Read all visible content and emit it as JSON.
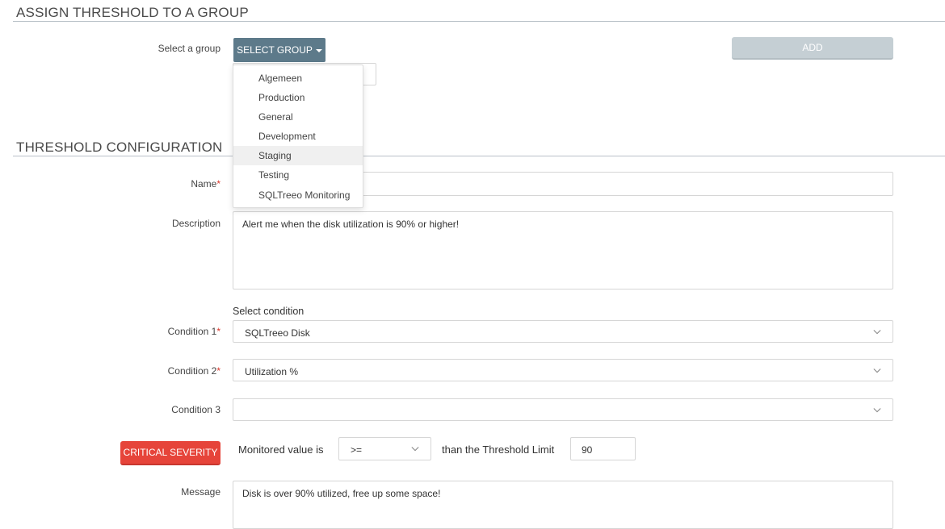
{
  "assign_section": {
    "title": "ASSIGN THRESHOLD TO A GROUP",
    "select_label": "Select a group",
    "select_button": "SELECT GROUP",
    "add_button": "ADD",
    "dropdown_items": [
      "Algemeen",
      "Production",
      "General",
      "Development",
      "Staging",
      "Testing",
      "SQLTreeo Monitoring"
    ],
    "highlighted_item": "Staging"
  },
  "config_section": {
    "title": "THRESHOLD CONFIGURATION",
    "name_label": "Name",
    "name_value": "",
    "description_label": "Description",
    "description_value": "Alert me when the disk utilization is 90% or higher!",
    "select_condition_heading": "Select condition",
    "condition1_label": "Condition 1",
    "condition1_value": "SQLTreeo Disk",
    "condition2_label": "Condition 2",
    "condition2_value": "Utilization %",
    "condition3_label": "Condition 3",
    "condition3_value": "",
    "required_marker": "*",
    "severity_button": "CRITICAL SEVERITY",
    "monitored_text": "Monitored value is",
    "operator_value": ">=",
    "threshold_text": "than the Threshold Limit",
    "threshold_value": "90",
    "message_label": "Message",
    "message_value": "Disk is over 90% utilized, free up some space!"
  },
  "colors": {
    "select_button_bg": "#5d7a8a",
    "add_button_bg": "#c5cfd4",
    "critical_bg": "#e6443a",
    "required": "#d9352a"
  },
  "icons": {
    "select_chevron": "chevron-down-icon",
    "dropdown_caret": "caret-down-icon"
  }
}
